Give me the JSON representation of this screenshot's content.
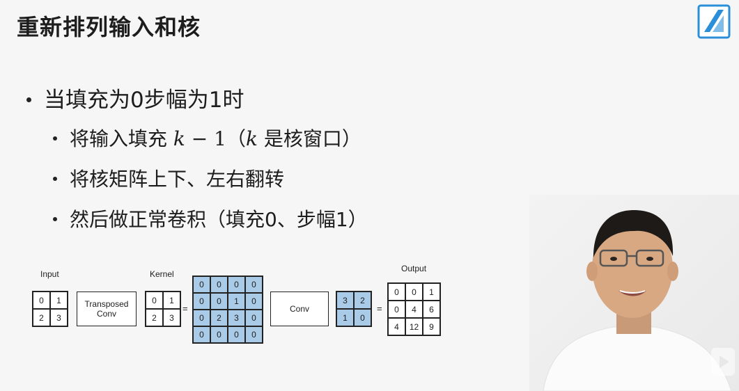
{
  "slide": {
    "title": "重新排列输入和核",
    "bullet_main": "当填充为0步幅为1时",
    "sub_bullets": [
      {
        "pre": "将输入填充 ",
        "math1": "k",
        "mid": " − 1（",
        "math2": "k",
        "post": " 是核窗口）"
      },
      {
        "text": "将核矩阵上下、左右翻转"
      },
      {
        "text": "然后做正常卷积（填充0、步幅1）"
      }
    ]
  },
  "diagram": {
    "input_label": "Input",
    "kernel_label": "Kernel",
    "output_label": "Output",
    "transposed_conv_label_line1": "Transposed",
    "transposed_conv_label_line2": "Conv",
    "conv_label": "Conv",
    "equals": "=",
    "input": [
      [
        "0",
        "1"
      ],
      [
        "2",
        "3"
      ]
    ],
    "kernel": [
      [
        "0",
        "1"
      ],
      [
        "2",
        "3"
      ]
    ],
    "padded": [
      [
        "0",
        "0",
        "0",
        "0"
      ],
      [
        "0",
        "0",
        "1",
        "0"
      ],
      [
        "0",
        "2",
        "3",
        "0"
      ],
      [
        "0",
        "0",
        "0",
        "0"
      ]
    ],
    "flipped_kernel": [
      [
        "3",
        "2"
      ],
      [
        "1",
        "0"
      ]
    ],
    "output": [
      [
        "0",
        "0",
        "1"
      ],
      [
        "0",
        "4",
        "6"
      ],
      [
        "4",
        "12",
        "9"
      ]
    ]
  },
  "colors": {
    "highlight": "#a9cbe8",
    "logo": "#2a8fd8",
    "background": "#f6f6f6"
  }
}
